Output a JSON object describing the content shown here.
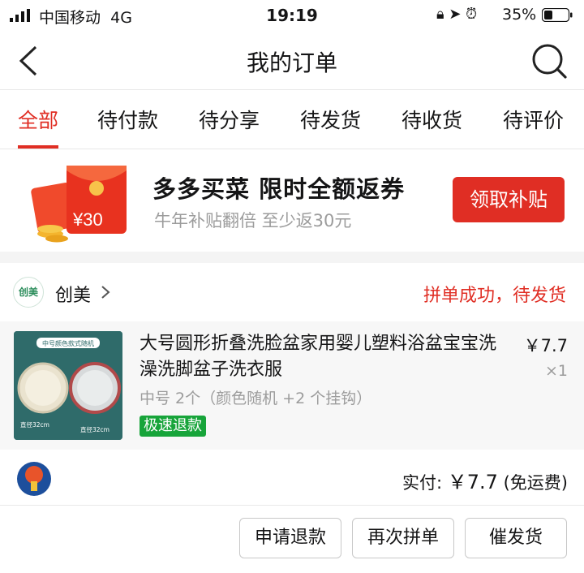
{
  "status_bar": {
    "carrier": "中国移动",
    "network": "4G",
    "time": "19:19",
    "battery": "35%",
    "icons": [
      "rotation-lock-icon",
      "location-icon",
      "alarm-icon"
    ]
  },
  "nav": {
    "title": "我的订单"
  },
  "tabs": [
    {
      "label": "全部",
      "active": true
    },
    {
      "label": "待付款"
    },
    {
      "label": "待分享"
    },
    {
      "label": "待发货"
    },
    {
      "label": "待收货"
    },
    {
      "label": "待评价"
    }
  ],
  "promo": {
    "envelope_text": "¥30",
    "headline": "多多买菜 限时全额返券",
    "sub": "牛年补贴翻倍 至少返30元",
    "button": "领取补贴"
  },
  "order": {
    "shop_logo_text": "创美",
    "shop_name": "创美",
    "status": "拼单成功，待发货",
    "item": {
      "title": "大号圆形折叠洗脸盆家用婴儿塑料浴盆宝宝洗澡洗脚盆子洗衣服",
      "spec": "中号 2个（颜色随机 +2 个挂钩）",
      "badge": "极速退款",
      "price": "￥7.7",
      "qty": "×1",
      "thumb_label": "中号颜色款式随机",
      "thumb_dim_left": "直径32cm",
      "thumb_dim_right": "直径32cm"
    },
    "paid_label": "实付:",
    "paid_amount": "￥7.7",
    "shipping_note": "(免运费)",
    "buttons": [
      "申请退款",
      "再次拼单",
      "催发货"
    ]
  },
  "colors": {
    "accent": "#e02e24",
    "refund_badge": "#17a43a"
  }
}
